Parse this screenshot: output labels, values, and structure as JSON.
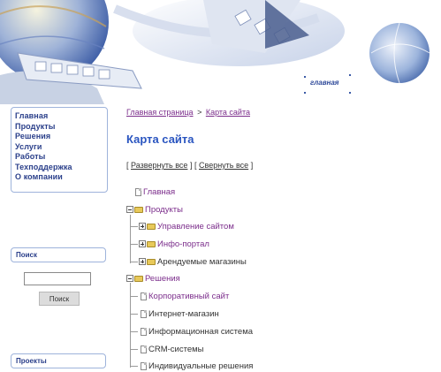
{
  "header": {
    "home_link_label": "главная"
  },
  "sidebar": {
    "nav_items": [
      {
        "label": "Главная"
      },
      {
        "label": "Продукты"
      },
      {
        "label": "Решения"
      },
      {
        "label": "Услуги"
      },
      {
        "label": "Работы"
      },
      {
        "label": "Техподдержка"
      },
      {
        "label": "О компании"
      }
    ],
    "search": {
      "header": "Поиск",
      "input_value": "",
      "button_label": "Поиск"
    },
    "projects_header": "Проекты"
  },
  "main": {
    "breadcrumb": {
      "home": "Главная страница",
      "separator": ">",
      "current": "Карта сайта"
    },
    "title": "Карта сайта",
    "toggle": {
      "open_bracket": "[",
      "expand_all": "Развернуть все",
      "close_bracket": "]",
      "collapse_all": "Свернуть все"
    },
    "tree": {
      "root": "Главная",
      "products": {
        "label": "Продукты",
        "children": [
          "Управление сайтом",
          "Инфо-портал",
          "Арендуемые магазины"
        ]
      },
      "solutions": {
        "label": "Решения",
        "children": [
          "Корпоративный сайт",
          "Интернет-магазин",
          "Информационная система",
          "CRM-системы",
          "Индивидуальные решения"
        ]
      }
    }
  },
  "colors": {
    "nav_text": "#2a3f8a",
    "link_purple": "#7b2d8b",
    "title_blue": "#2a55c0",
    "box_border": "#9eb3db"
  }
}
